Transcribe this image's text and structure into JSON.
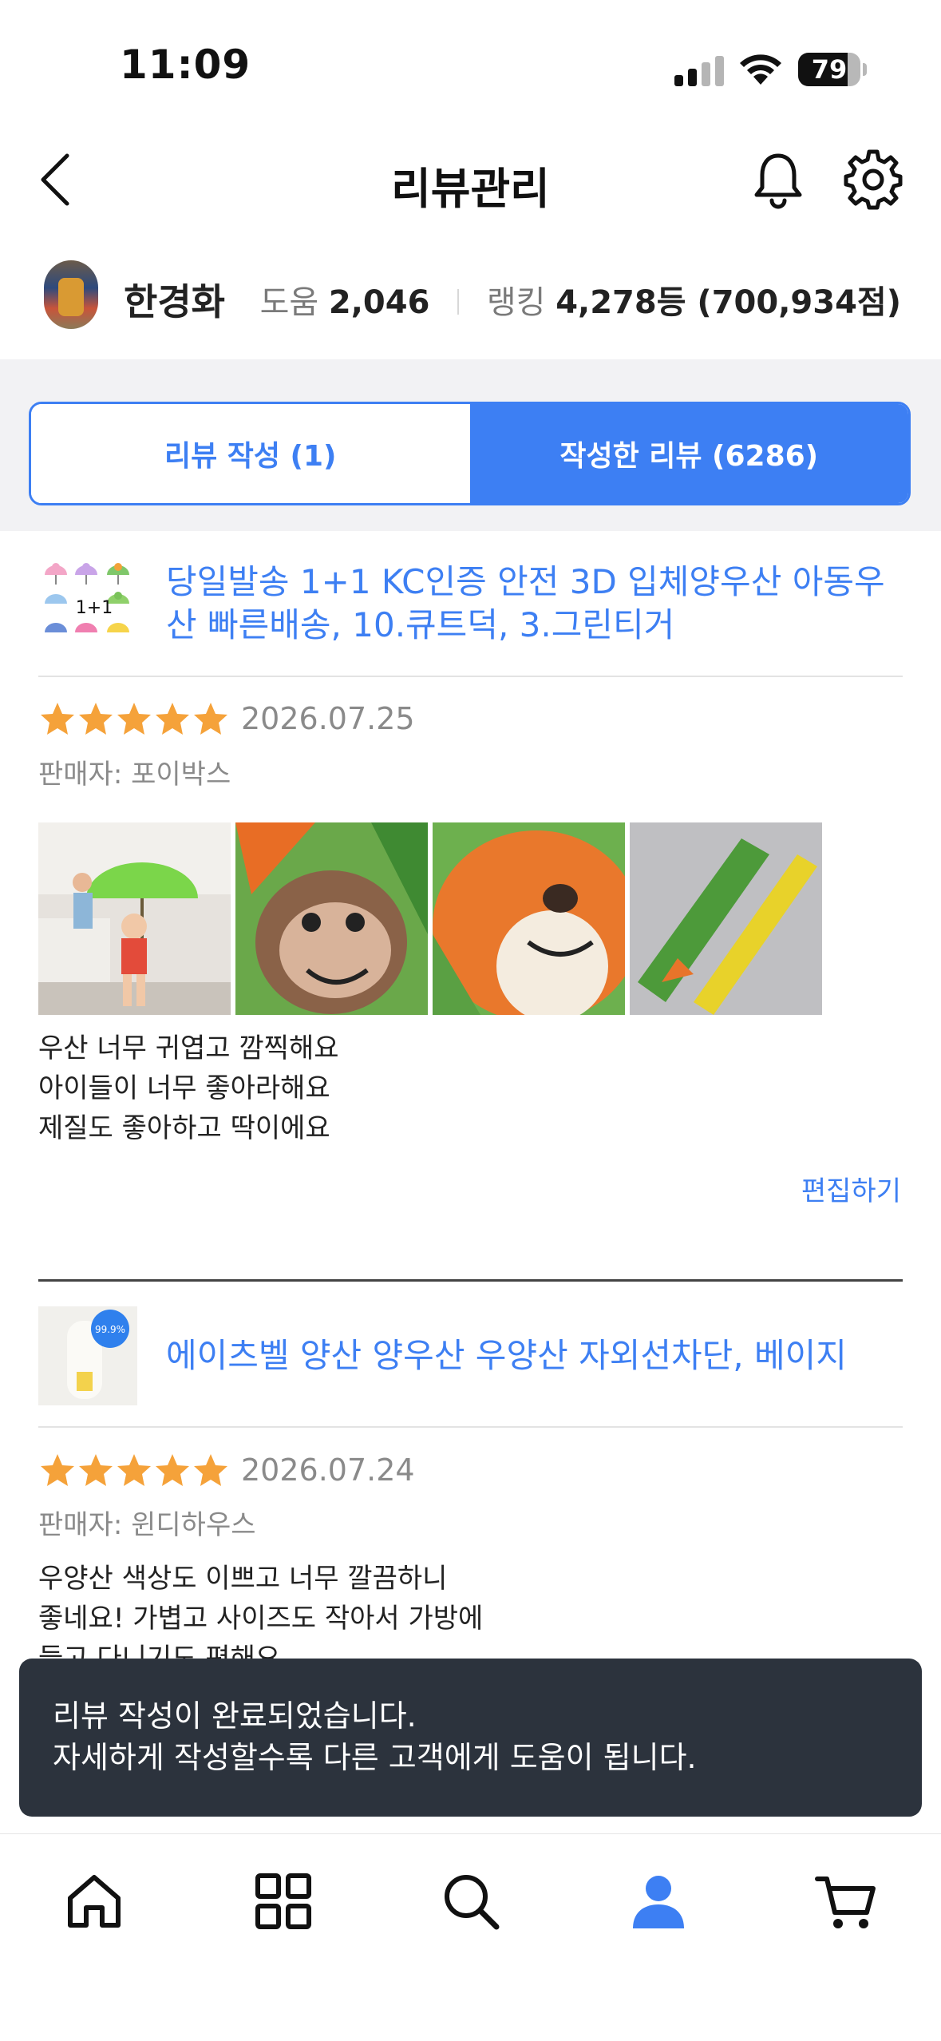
{
  "status_bar": {
    "time": "11:09",
    "battery": "79",
    "battery_level": 0.79
  },
  "header": {
    "title": "리뷰관리"
  },
  "profile": {
    "name": "한경화",
    "help_label": "도움",
    "help_value": "2,046",
    "ranking_label": "랭킹",
    "ranking_value": "4,278등 (700,934점)"
  },
  "tabs": [
    {
      "label": "리뷰 작성 (1)",
      "active": false
    },
    {
      "label": "작성한 리뷰 (6286)",
      "active": true
    }
  ],
  "reviews": [
    {
      "product": "당일발송 1+1 KC인증 안전 3D 입체양우산 아동우산 빠른배송, 10.큐트덕, 3.그린티거",
      "thumb_badge": "1+1",
      "rating": 5,
      "date": "2026.07.25",
      "seller": "판매자: 포이박스",
      "text": "우산 너무 귀엽고 깜찍해요\n아이들이 너무 좋아라해요\n제질도 좋아하고 딱이에요",
      "edit": "편집하기"
    },
    {
      "product": "에이츠벨 양산 양우산 우양산 자외선차단, 베이지",
      "thumb_badge": "99.9%",
      "rating": 5,
      "date": "2026.07.24",
      "seller": "판매자: 윈디하우스",
      "text": "우양산 색상도 이쁘고 너무 깔끔하니\n좋네요! 가볍고 사이즈도 작아서 가방에\n들고 다니기도 편해요"
    }
  ],
  "toast": {
    "line1": "리뷰 작성이 완료되었습니다.",
    "line2": "자세하게 작성할수록 다른 고객에게 도움이 됩니다."
  },
  "bottom_nav": [
    {
      "icon": "home-icon"
    },
    {
      "icon": "category-grid-icon"
    },
    {
      "icon": "search-icon"
    },
    {
      "icon": "my-page-person-icon",
      "active": true
    },
    {
      "icon": "cart-icon"
    }
  ],
  "colors": {
    "accent": "#3d7ff3",
    "star": "#f5a23a",
    "toast_bg": "#2c333d"
  }
}
